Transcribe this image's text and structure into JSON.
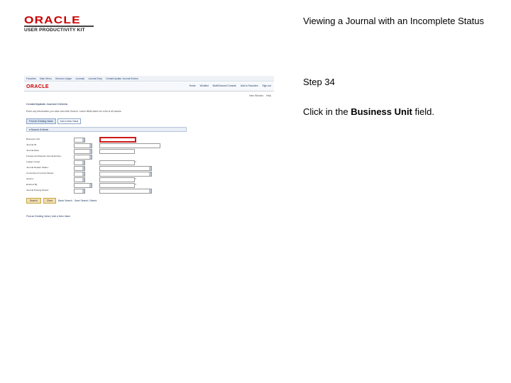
{
  "header": {
    "logo_brand": "ORACLE",
    "logo_product": "USER PRODUCTIVITY KIT",
    "title": "Viewing a Journal with an Incomplete Status"
  },
  "step": {
    "label": "Step 34",
    "instruction_prefix": "Click in the ",
    "instruction_target": "Business Unit",
    "instruction_suffix": " field."
  },
  "screenshot": {
    "breadcrumbs": [
      "Favorites",
      "Main Menu",
      "General Ledger",
      "Journals",
      "Journal Entry",
      "Create/Update Journal Entries"
    ],
    "brand": "ORACLE",
    "header_links": [
      "Home",
      "Worklist",
      "MultiChannel Console",
      "Add to Favorites",
      "Sign out"
    ],
    "util_links": [
      "New Window",
      "Help"
    ],
    "page_title": "Create/Update Journal Criteria",
    "page_instruction": "Enter any information you have and click Search. Leave fields blank for a list of all values.",
    "tabs": [
      "Find an Existing Value",
      "Add a New Value"
    ],
    "criteria_header": "Search Criteria",
    "fields": [
      {
        "label": "Business Unit:",
        "op": "=",
        "kind": "text",
        "highlight": true
      },
      {
        "label": "Journal ID:",
        "op": "begins with",
        "kind": "text"
      },
      {
        "label": "Journal Date:",
        "op": "=",
        "kind": "text"
      },
      {
        "label": "Foreign and Repeat Journal Entries:",
        "op": "begins with",
        "kind": "text"
      },
      {
        "label": "Ledger Group:",
        "op": "=",
        "kind": "text"
      },
      {
        "label": "Journal Header Status:",
        "op": "=",
        "kind": "select"
      },
      {
        "label": "Commitment Control Status:",
        "op": "=",
        "kind": "select"
      },
      {
        "label": "Source:",
        "op": "=",
        "kind": "text"
      },
      {
        "label": "Entered By:",
        "op": "begins with",
        "kind": "text"
      },
      {
        "label": "Journal Posting Status:",
        "op": "=",
        "kind": "select"
      }
    ],
    "buttons": {
      "search": "Search",
      "clear": "Clear"
    },
    "basic_search": "Basic Search",
    "save_criteria": "Save Search Criteria",
    "footer_links": "Find an Existing Value | Add a New Value"
  },
  "colors": {
    "highlight": "#cc1a1a",
    "oracle_red": "#cc0000"
  }
}
